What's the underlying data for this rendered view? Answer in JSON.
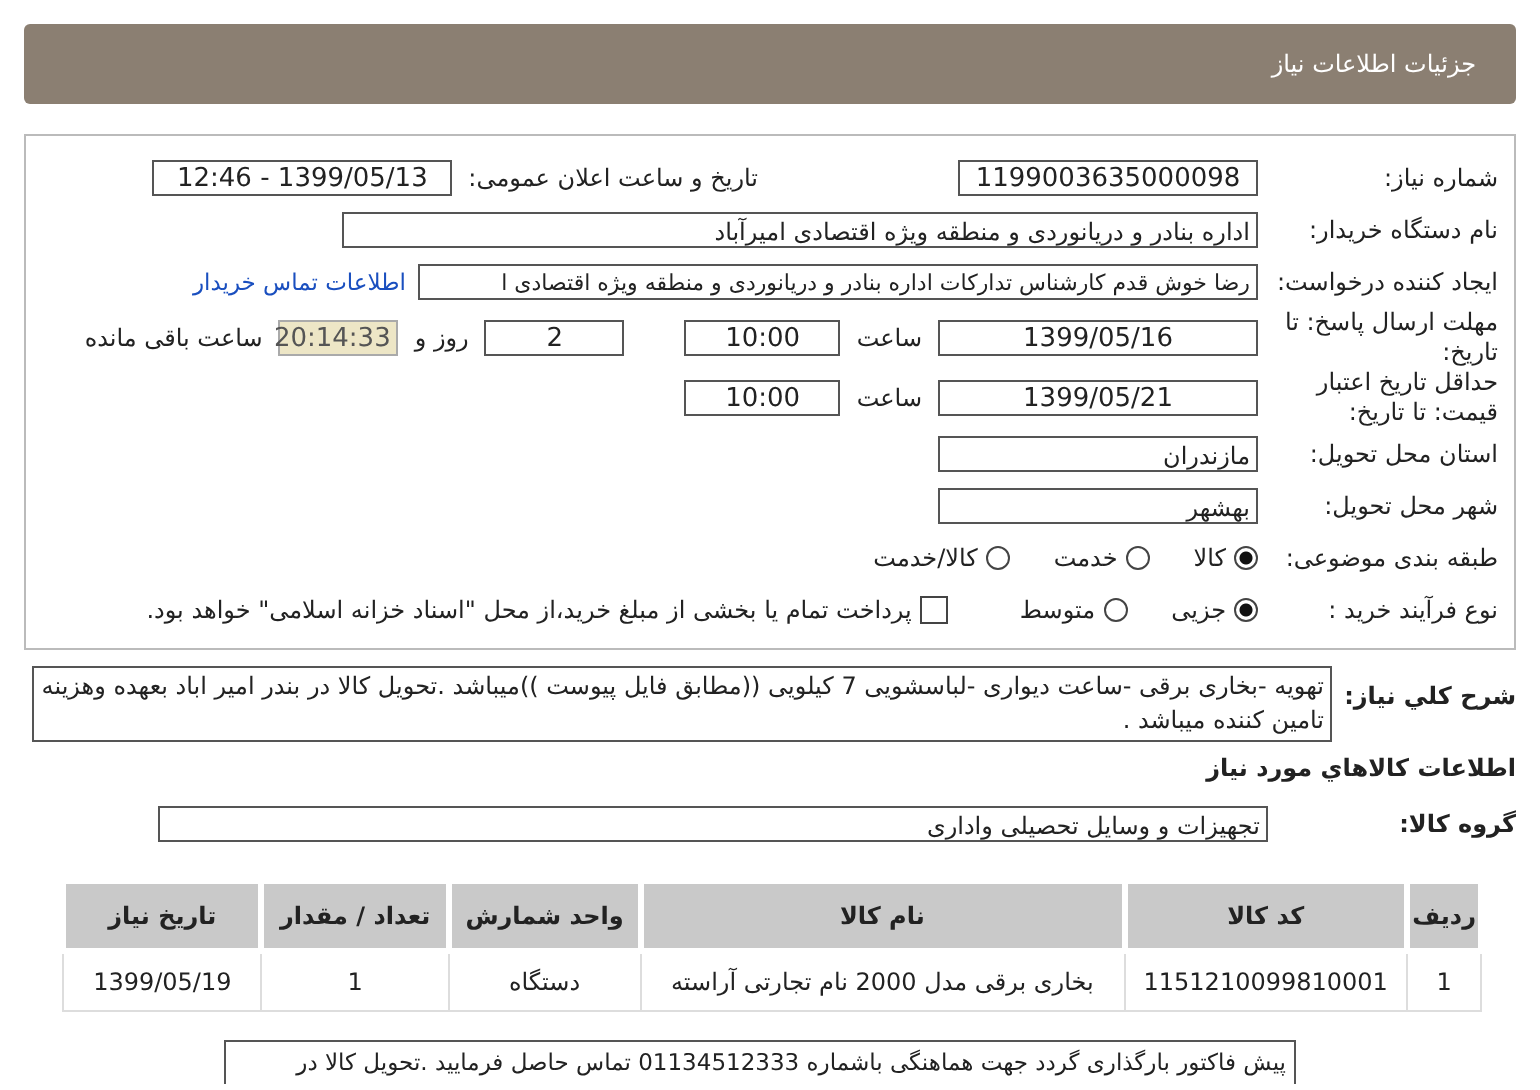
{
  "header": {
    "title": "جزئیات اطلاعات نیاز"
  },
  "need_number": {
    "label": "شماره نیاز:",
    "value": "1199003635000098"
  },
  "announce": {
    "label": "تاریخ و ساعت اعلان عمومی:",
    "value": "1399/05/13 - 12:46"
  },
  "buyer": {
    "label": "نام دستگاه خریدار:",
    "value": "اداره بنادر و دریانوردی و منطقه ویژه اقتصادی امیرآباد"
  },
  "creator": {
    "label": "ایجاد کننده درخواست:",
    "value": "رضا خوش قدم کارشناس تدارکات اداره بنادر و دریانوردی و منطقه ویژه اقتصادی ا",
    "link": "اطلاعات تماس خریدار"
  },
  "deadline": {
    "label": "مهلت ارسال پاسخ: تا تاریخ:",
    "date": "1399/05/16",
    "time_label": "ساعت",
    "time": "10:00",
    "days": "2",
    "days_label": "روز و",
    "remaining": "20:14:33",
    "remaining_label": "ساعت باقی مانده"
  },
  "validity": {
    "label": "حداقل تاریخ اعتبار قیمت: تا تاریخ:",
    "date": "1399/05/21",
    "time_label": "ساعت",
    "time": "10:00"
  },
  "province": {
    "label": "استان محل تحویل:",
    "value": "مازندران"
  },
  "city": {
    "label": "شهر محل تحویل:",
    "value": "بهشهر"
  },
  "category": {
    "label": "طبقه بندی موضوعی:",
    "options": [
      {
        "label": "کالا",
        "selected": true
      },
      {
        "label": "خدمت",
        "selected": false
      },
      {
        "label": "کالا/خدمت",
        "selected": false
      }
    ]
  },
  "process": {
    "label": "نوع فرآیند خرید :",
    "options": [
      {
        "label": "جزیی",
        "selected": true
      },
      {
        "label": "متوسط",
        "selected": false
      }
    ],
    "treasury": {
      "label": "پرداخت تمام یا بخشی از مبلغ خرید،از محل \"اسناد خزانه اسلامی\" خواهد بود.",
      "checked": false
    }
  },
  "description": {
    "label": "شرح کلي نياز:",
    "value": "تهویه -بخاری برقی -ساعت دیواری -لباسشویی 7 کیلویی ((مطابق فایل پیوست ))میباشد .تحویل کالا در بندر امیر اباد بعهده وهزینه تامین کننده میباشد ."
  },
  "goods_title": "اطلاعات کالاهاي مورد نياز",
  "goods_group": {
    "label": "گروه کالا:",
    "value": "تجهیزات و وسایل تحصیلی واداری"
  },
  "table": {
    "columns": [
      "ردیف",
      "کد کالا",
      "نام کالا",
      "واحد شمارش",
      "تعداد / مقدار",
      "تاریخ نیاز"
    ],
    "rows": [
      [
        "1",
        "1151210099810001",
        "بخاری برقی مدل 2000 نام تجارتی آراسته",
        "دستگاه",
        "1",
        "1399/05/19"
      ]
    ]
  },
  "note": "پیش فاکتور بارگذاری گردد جهت هماهنگی باشماره 01134512333 تماس حاصل فرمایید .تحویل کالا در"
}
